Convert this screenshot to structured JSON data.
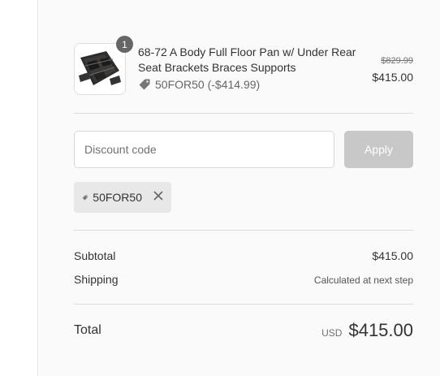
{
  "product": {
    "quantity": "1",
    "title": "68-72 A Body Full Floor Pan w/ Under Rear Seat Brackets Braces Supports",
    "discount_text": "50FOR50 (-$414.99)",
    "original_price": "$829.99",
    "price": "$415.00",
    "thumbnail_icon": "floor-pan-image"
  },
  "discount": {
    "placeholder": "Discount code",
    "value": "",
    "apply_label": "Apply",
    "applied_code": "50FOR50",
    "remove_icon": "close-icon"
  },
  "summary": {
    "subtotal_label": "Subtotal",
    "subtotal_value": "$415.00",
    "shipping_label": "Shipping",
    "shipping_value": "Calculated at next step",
    "total_label": "Total",
    "currency": "USD",
    "total_value": "$415.00"
  }
}
